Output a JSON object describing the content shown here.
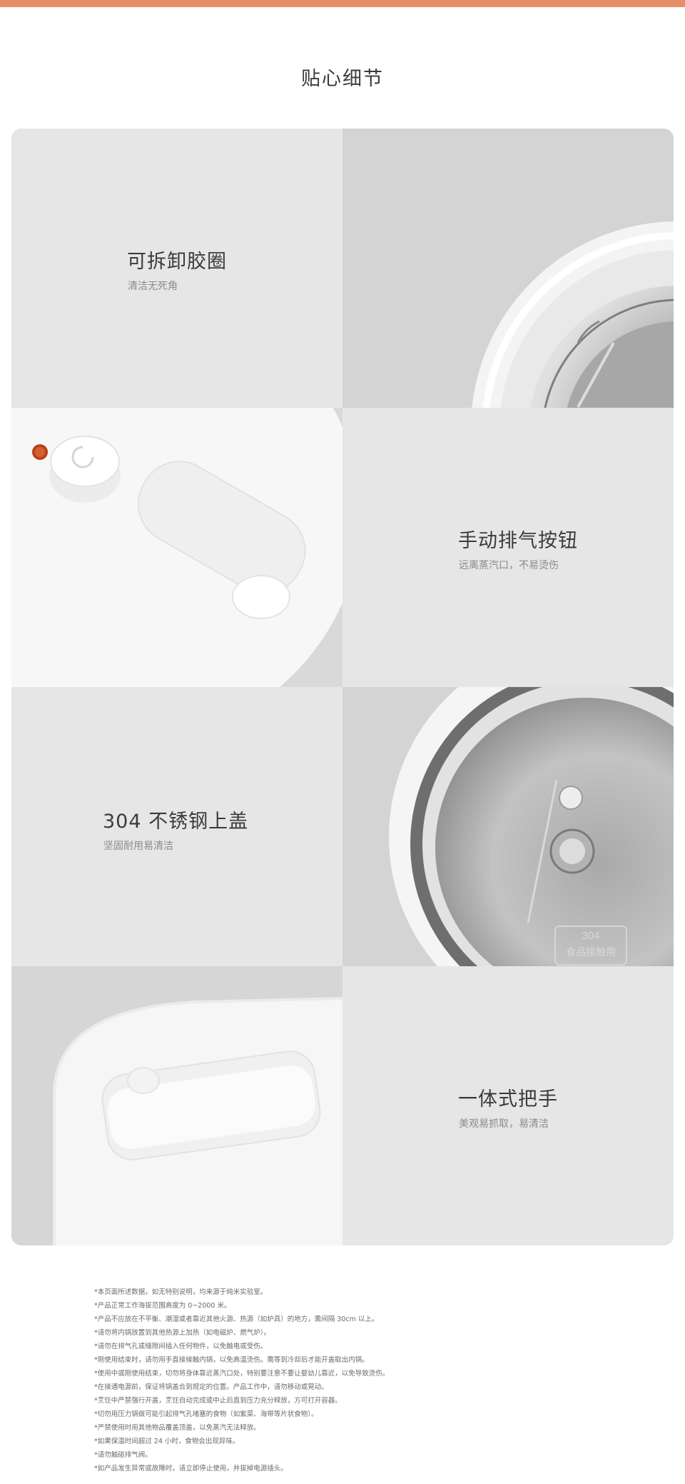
{
  "page": {
    "title": "贴心细节",
    "accent_color": "#e58f69"
  },
  "features": [
    {
      "title": "可拆卸胶圈",
      "subtitle": "清洁无死角",
      "image": "sealing-ring-photo"
    },
    {
      "title": "手动排气按钮",
      "subtitle": "远离蒸汽口，不易烫伤",
      "image": "exhaust-button-photo"
    },
    {
      "title": "304 不锈钢上盖",
      "subtitle": "坚固耐用易清洁",
      "image": "steel-lid-photo"
    },
    {
      "title": "一体式把手",
      "subtitle": "美观易抓取，易清洁",
      "image": "handle-photo"
    }
  ],
  "lid_stamp": {
    "line1": "304",
    "line2": "食品接触用"
  },
  "notes": [
    "*本页面所述数据，如无特别说明，均来源于纯米实验室。",
    "*产品正常工作海拔范围高度为 0~2000 米。",
    "*产品不应放在不平衡、潮湿或者靠近其他火源、热源（如炉具）的地方，需间隔 30cm 以上。",
    "*请勿将内锅放置到其他热源上加热（如电磁炉、燃气炉）。",
    "*请勿在排气孔或缝隙间插入任何物件，以免触电或受伤。",
    "*刚使用结束时，请勿用手直接接触内锅，以免高温烫伤。需等到冷却后才能开盖取出内锅。",
    "*使用中或刚使用结束，切勿将身体靠近蒸汽口处，特别要注意不要让婴幼儿靠近，以免导致烫伤。",
    "*在接通电源前，保证将锅盖合到规定的位置。产品工作中，请勿移动或晃动。",
    "*烹饪中严禁强行开盖，烹饪自动完成或中止后直到压力充分释放，方可打开容器。",
    "*切勿用压力锅做可能引起排气孔堵塞的食物（如紫菜、海带等片状食物）。",
    "*严禁使用时用其他物品覆盖顶盖，以免蒸汽无法释放。",
    "*如果保温时间超过 24 小时，食物会出现异味。",
    "*请勿触碰排气阀。",
    "*如产品发生异常或故障时，请立即停止使用，并拔掉电源插头。"
  ]
}
